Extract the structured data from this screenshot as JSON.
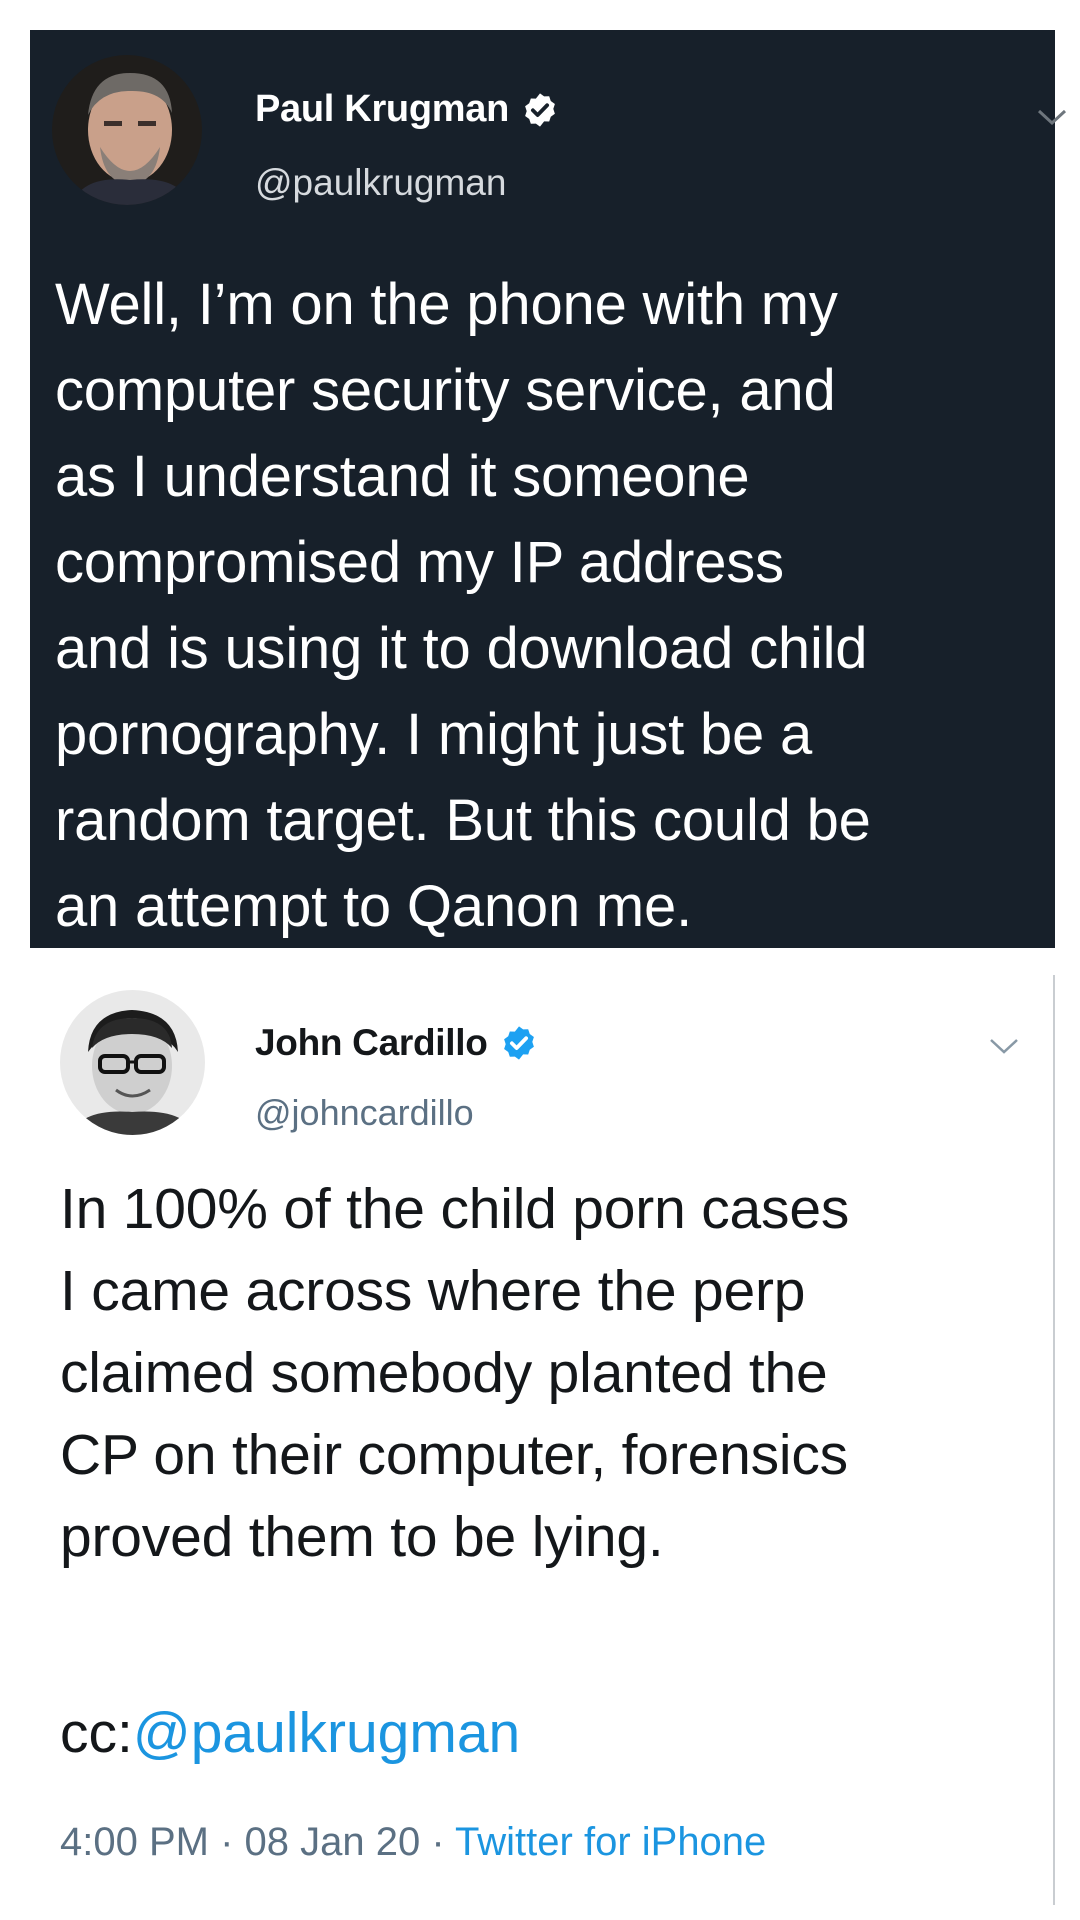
{
  "tweets": [
    {
      "author_name": "Paul Krugman",
      "handle": "@paulkrugman",
      "verified": true,
      "text": "Well, I’m on the phone with my\ncomputer security service, and\nas I understand it someone\ncompromised my IP address\nand is using it to download child\npornography. I might just be a\nrandom target. But this could be\nan attempt to Qanon me."
    },
    {
      "author_name": "John Cardillo",
      "handle": "@johncardillo",
      "verified": true,
      "text": "In 100% of the child porn cases\nI came across where the perp\nclaimed somebody planted the\nCP on their computer, forensics\nproved them to be lying.",
      "cc_prefix": "cc:",
      "cc_mention": "@paulkrugman",
      "time": "4:00 PM",
      "date": "08 Jan 20",
      "separator": " · ",
      "source": "Twitter for iPhone"
    }
  ],
  "colors": {
    "dark_bg": "#17202a",
    "link_blue": "#1b95e0",
    "muted_gray": "#5b7083",
    "verified_blue": "#1da1f2"
  },
  "icons": {
    "verified": "verified-badge-icon",
    "menu": "chevron-down-icon"
  }
}
